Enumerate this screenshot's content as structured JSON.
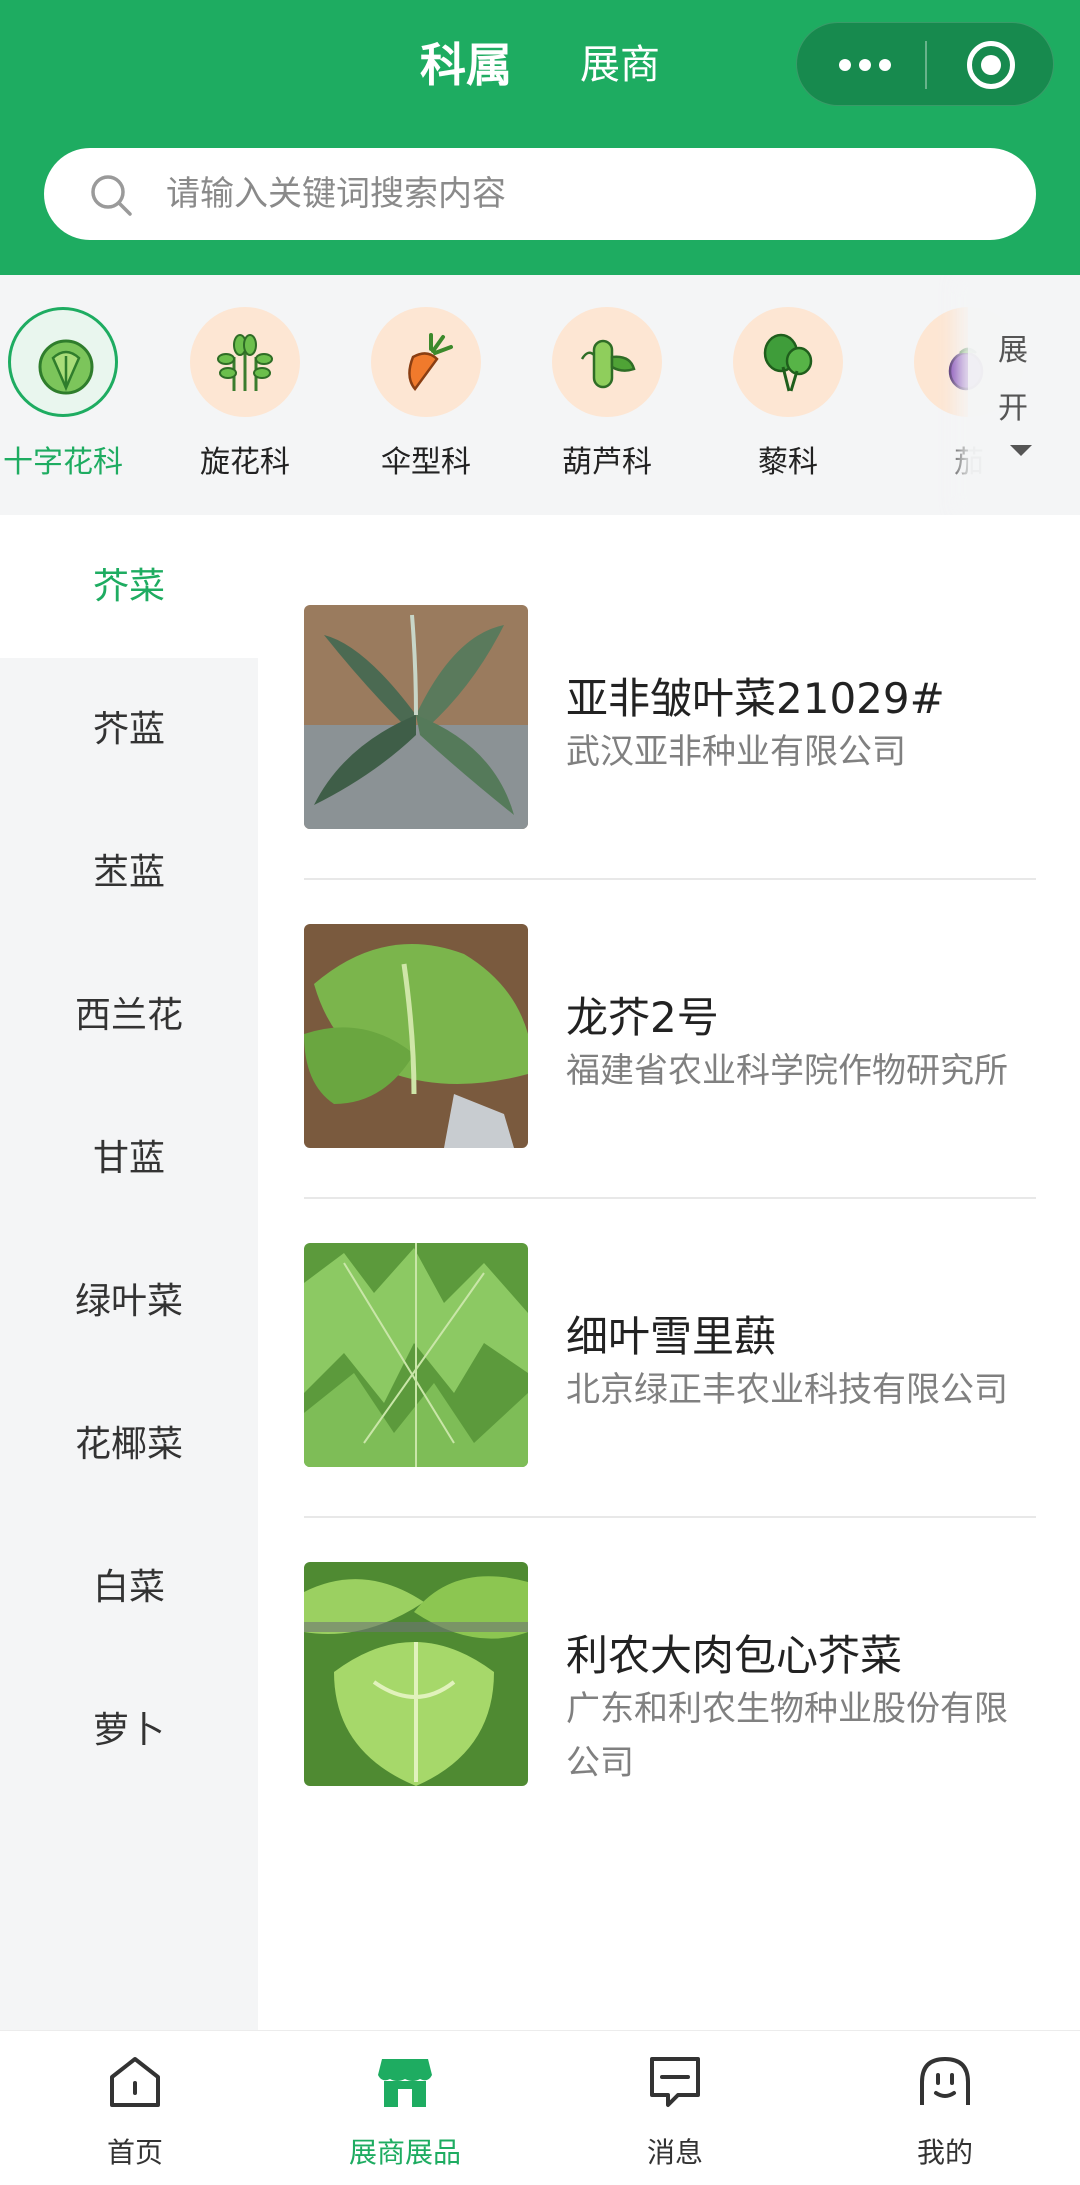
{
  "header": {
    "tabs": [
      "科属",
      "展商"
    ],
    "capsule_icons": [
      "more-dots-icon",
      "record-icon"
    ],
    "accent_color": "#1eac61"
  },
  "search": {
    "placeholder": "请输入关键词搜索内容"
  },
  "categories": {
    "items": [
      {
        "label": "十字花科",
        "icon": "cabbage-icon",
        "active": true
      },
      {
        "label": "旋花科",
        "icon": "sprout-icon"
      },
      {
        "label": "伞型科",
        "icon": "carrot-icon"
      },
      {
        "label": "葫芦科",
        "icon": "cucumber-icon"
      },
      {
        "label": "藜科",
        "icon": "spinach-icon"
      },
      {
        "label": "茄",
        "icon": "eggplant-icon"
      }
    ],
    "expand_line1": "展",
    "expand_line2": "开"
  },
  "sidebar": {
    "items": [
      {
        "label": "芥菜",
        "active": true
      },
      {
        "label": "芥蓝"
      },
      {
        "label": "苤蓝"
      },
      {
        "label": "西兰花"
      },
      {
        "label": "甘蓝"
      },
      {
        "label": "绿叶菜"
      },
      {
        "label": "花椰菜"
      },
      {
        "label": "白菜"
      },
      {
        "label": "萝卜"
      }
    ]
  },
  "products": [
    {
      "name": "亚非皱叶菜21029#",
      "company": "武汉亚非种业有限公司"
    },
    {
      "name": "龙芥2号",
      "company": "福建省农业科学院作物研究所"
    },
    {
      "name": "细叶雪里蕻",
      "company": "北京绿正丰农业科技有限公司"
    },
    {
      "name": "利农大肉包心芥菜",
      "company": "广东和利农生物种业股份有限公司"
    }
  ],
  "tabbar": {
    "items": [
      {
        "label": "首页",
        "icon": "home-icon"
      },
      {
        "label": "展商展品",
        "icon": "store-icon",
        "active": true
      },
      {
        "label": "消息",
        "icon": "message-icon"
      },
      {
        "label": "我的",
        "icon": "profile-icon"
      }
    ]
  }
}
